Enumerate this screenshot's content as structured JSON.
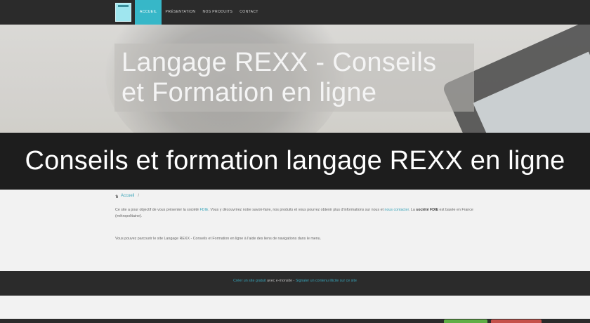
{
  "nav": {
    "items": [
      {
        "label": "ACCUEIL",
        "active": true
      },
      {
        "label": "PRÉSENTATION",
        "active": false
      },
      {
        "label": "NOS PRODUITS",
        "active": false
      },
      {
        "label": "CONTACT",
        "active": false
      }
    ]
  },
  "hero": {
    "title_line1": "Langage REXX - Conseils",
    "title_line2": "et Formation en ligne"
  },
  "overlay": {
    "text": "Conseils et formation langage REXX en ligne"
  },
  "breadcrumb": {
    "home": "Accueil",
    "separator": "/"
  },
  "content": {
    "p1_part1": "Ce site a pour objectif de vous présenter la société ",
    "p1_company": "FDIE",
    "p1_part2": ". Vous y découvrirez notre savoir-faire, nos produits et vous pourrez obtenir plus d'informations sur nous et ",
    "p1_link": "nous contacter",
    "p1_part3": ". La ",
    "p1_company_bold": "société FDIE",
    "p1_part4": " est basée en France (métropolitaine).",
    "p2": "Vous pouvez parcourir le site Langage REXX - Conseils et Formation en ligne à l'aide des liens de navigations dans le menu."
  },
  "footer": {
    "link1": "Créer un site gratuit",
    "text1": " avec e-monsite",
    "separator": " - ",
    "link2": "Signaler un contenu illicite sur ce site"
  },
  "colors": {
    "accent": "#37b7c8",
    "navbar": "#2b2b2b",
    "overlay": "#1d1d1d",
    "link": "#37a3b8",
    "bottom_green": "#5fae45",
    "bottom_red": "#c5514a"
  }
}
